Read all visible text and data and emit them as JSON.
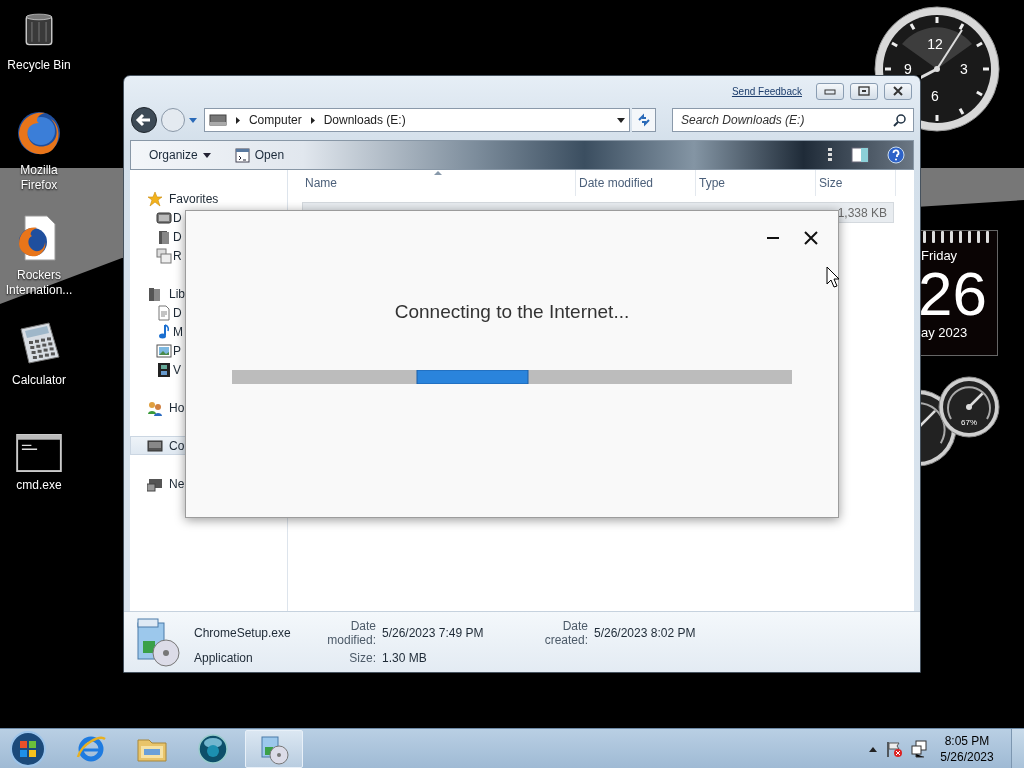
{
  "desktop_icons": [
    {
      "label": "Recycle Bin",
      "kind": "recycle"
    },
    {
      "label": "Mozilla Firefox",
      "kind": "firefox"
    },
    {
      "label": "Rockers Internation...",
      "kind": "firefox-doc"
    },
    {
      "label": "Calculator",
      "kind": "calculator"
    },
    {
      "label": "cmd.exe",
      "kind": "cmd"
    }
  ],
  "gadgets": {
    "clock": {
      "numerals": [
        "12",
        "3",
        "6",
        "9"
      ]
    },
    "calendar": {
      "weekday": "Friday",
      "day": "26",
      "month": "ay 2023"
    },
    "meter": {
      "reading": "67%"
    }
  },
  "explorer": {
    "send_feedback": "Send Feedback",
    "address": {
      "crumbs": [
        "Computer",
        "Downloads (E:)"
      ]
    },
    "search": {
      "placeholder": "Search Downloads (E:)"
    },
    "toolbar": [
      {
        "label": "Organize",
        "kind": "menu"
      },
      {
        "label": "Open",
        "kind": "open"
      }
    ],
    "nav": [
      {
        "label": "Favorites",
        "kind": "star",
        "selected": false,
        "children": [
          {
            "label": "D",
            "kind": "desktop",
            "selected": false
          },
          {
            "label": "D",
            "kind": "downloads",
            "selected": false
          },
          {
            "label": "R",
            "kind": "recent",
            "selected": false
          }
        ]
      },
      {
        "label": "Lib",
        "kind": "library",
        "selected": false,
        "children": [
          {
            "label": "D",
            "kind": "documents",
            "selected": false
          },
          {
            "label": "M",
            "kind": "music",
            "selected": false
          },
          {
            "label": "P",
            "kind": "pictures",
            "selected": false
          },
          {
            "label": "V",
            "kind": "videos",
            "selected": false
          }
        ]
      },
      {
        "label": "Ho",
        "kind": "homegroup",
        "selected": false
      },
      {
        "label": "Co",
        "kind": "computer",
        "selected": true
      },
      {
        "label": "Ne",
        "kind": "network",
        "selected": false
      }
    ],
    "columns": [
      "Name",
      "Date modified",
      "Type",
      "Size"
    ],
    "rows": [
      {
        "size": "1,338 KB",
        "selected": true
      }
    ],
    "details": {
      "name": "ChromeSetup.exe",
      "type": "Application",
      "fields": [
        {
          "label": "Date modified:",
          "value": "5/26/2023 7:49 PM"
        },
        {
          "label": "Date created:",
          "value": "5/26/2023 8:02 PM"
        },
        {
          "label": "Size:",
          "value": "1.30 MB"
        }
      ]
    }
  },
  "dialog": {
    "message": "Connecting to the Internet..."
  },
  "taskbar": {
    "items": [
      {
        "kind": "ie",
        "selected": false
      },
      {
        "kind": "folder",
        "selected": false
      },
      {
        "kind": "media",
        "selected": false
      },
      {
        "kind": "setup",
        "selected": true
      }
    ],
    "time": "8:05 PM",
    "date": "5/26/2023"
  }
}
